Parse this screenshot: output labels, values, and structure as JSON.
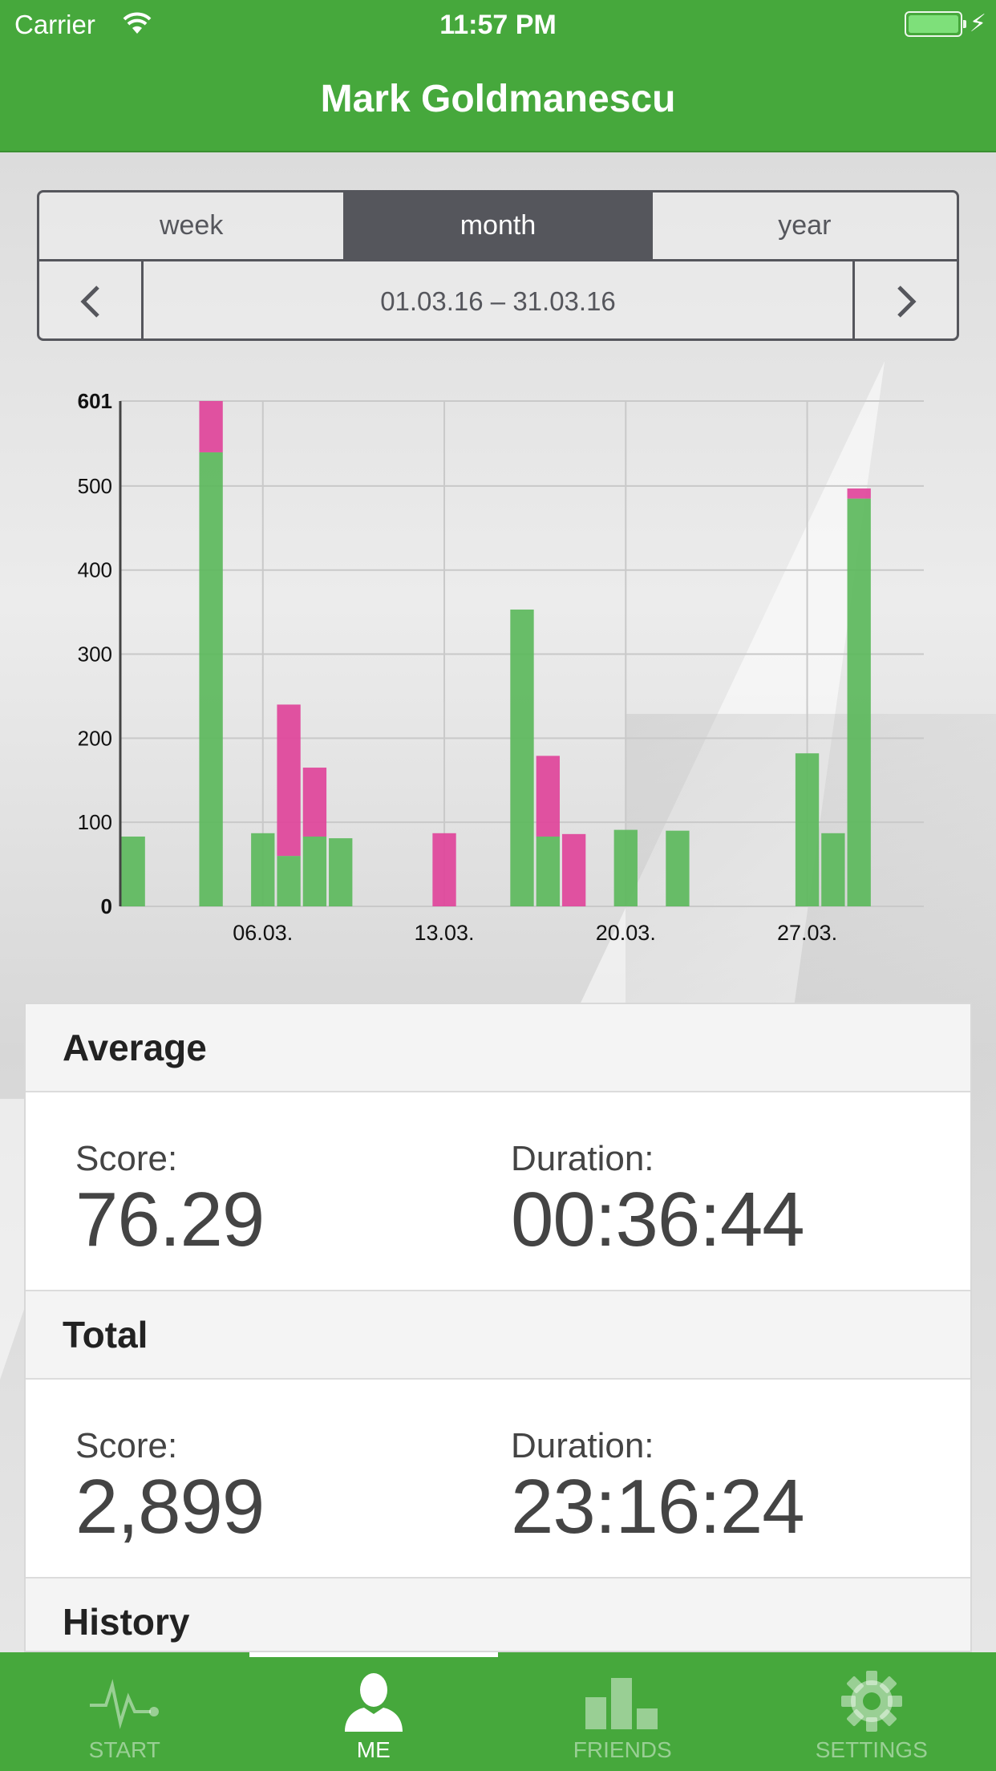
{
  "status_bar": {
    "carrier": "Carrier",
    "time": "11:57 PM"
  },
  "nav": {
    "title": "Mark Goldmanescu"
  },
  "period_tabs": [
    {
      "label": "week",
      "active": false
    },
    {
      "label": "month",
      "active": true
    },
    {
      "label": "year",
      "active": false
    }
  ],
  "date_range": "01.03.16 – 31.03.16",
  "chart_data": {
    "type": "bar",
    "stacked": true,
    "colors": {
      "green": "#5cb85c",
      "pink": "#e0449a"
    },
    "ylim": [
      0,
      601
    ],
    "ytick_values": [
      0,
      100,
      200,
      300,
      400,
      500,
      601
    ],
    "ytick_labels": [
      "0",
      "100",
      "200",
      "300",
      "400",
      "500",
      "601"
    ],
    "xtick_labels": [
      {
        "day": 6,
        "label": "06.03."
      },
      {
        "day": 13,
        "label": "13.03."
      },
      {
        "day": 20,
        "label": "20.03."
      },
      {
        "day": 27,
        "label": "27.03."
      }
    ],
    "x": [
      1,
      2,
      3,
      4,
      5,
      6,
      7,
      8,
      9,
      10,
      11,
      12,
      13,
      14,
      15,
      16,
      17,
      18,
      19,
      20,
      21,
      22,
      23,
      24,
      25,
      26,
      27,
      28,
      29,
      30,
      31
    ],
    "series": [
      {
        "color": "green",
        "values": [
          83,
          0,
          0,
          540,
          0,
          87,
          60,
          83,
          81,
          0,
          0,
          0,
          0,
          0,
          0,
          353,
          83,
          0,
          0,
          91,
          0,
          90,
          0,
          0,
          0,
          0,
          182,
          87,
          485,
          0,
          0
        ]
      },
      {
        "color": "pink",
        "values": [
          0,
          0,
          0,
          61,
          0,
          0,
          180,
          82,
          0,
          0,
          0,
          0,
          87,
          0,
          0,
          0,
          96,
          86,
          0,
          0,
          0,
          0,
          0,
          0,
          0,
          0,
          0,
          0,
          12,
          0,
          0
        ]
      }
    ]
  },
  "average": {
    "heading": "Average",
    "score_label": "Score:",
    "score_value": "76.29",
    "duration_label": "Duration:",
    "duration_value": "00:36:44"
  },
  "total": {
    "heading": "Total",
    "score_label": "Score:",
    "score_value": "2,899",
    "duration_label": "Duration:",
    "duration_value": "23:16:24"
  },
  "history": {
    "heading": "History"
  },
  "tabbar": [
    {
      "label": "START",
      "icon": "pulse-icon",
      "active": false
    },
    {
      "label": "ME",
      "icon": "person-icon",
      "active": true
    },
    {
      "label": "FRIENDS",
      "icon": "bar-chart-icon",
      "active": false
    },
    {
      "label": "SETTINGS",
      "icon": "gear-icon",
      "active": false
    }
  ]
}
